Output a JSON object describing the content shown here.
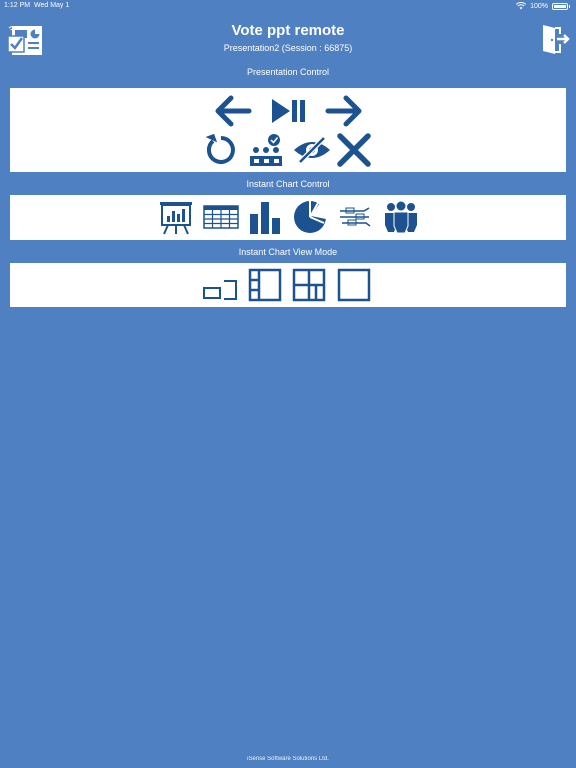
{
  "status_bar": {
    "time": "1:12 PM",
    "date": "Wed May 1",
    "battery": "100%"
  },
  "header": {
    "title": "Vote ppt remote",
    "subtitle": "Presentation2 (Session : 66875)",
    "left_icon": "vote-dashboard-icon",
    "right_icon": "exit-door-icon"
  },
  "sections": {
    "presentation_control": "Presentation Control",
    "instant_chart_control": "Instant Chart Control",
    "instant_chart_view_mode": "Instant Chart View Mode"
  },
  "footer": "iSense Software Solutions Ltd.",
  "colors": {
    "background": "#4f80c1",
    "icon": "#1d5290",
    "panel": "#ffffff"
  }
}
